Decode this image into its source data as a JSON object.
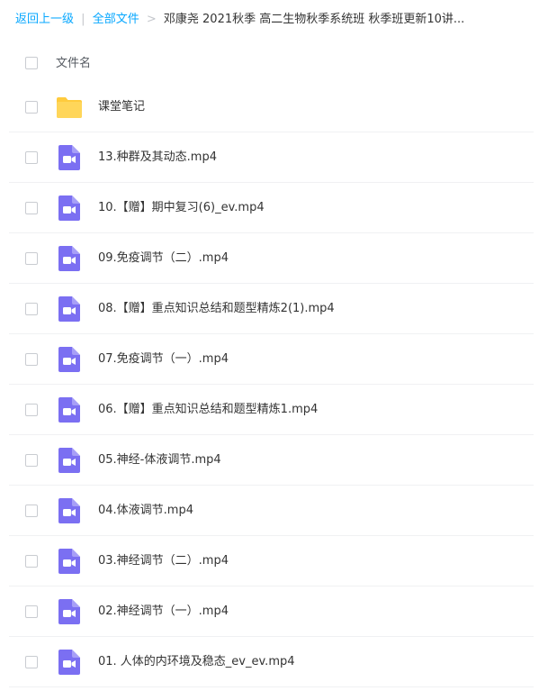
{
  "breadcrumb": {
    "back_label": "返回上一级",
    "separator": "|",
    "all_files_label": "全部文件",
    "chevron": ">",
    "current_path": "邓康尧 2021秋季 高二生物秋季系统班 秋季班更新10讲..."
  },
  "list_header": {
    "name_label": "文件名"
  },
  "files": [
    {
      "name": "课堂笔记",
      "icon": "folder-icon"
    },
    {
      "name": "13.种群及其动态.mp4",
      "icon": "video-icon"
    },
    {
      "name": "10.【赠】期中复习(6)_ev.mp4",
      "icon": "video-icon"
    },
    {
      "name": "09.免疫调节（二）.mp4",
      "icon": "video-icon"
    },
    {
      "name": "08.【赠】重点知识总结和题型精炼2(1).mp4",
      "icon": "video-icon"
    },
    {
      "name": "07.免疫调节（一）.mp4",
      "icon": "video-icon"
    },
    {
      "name": "06.【赠】重点知识总结和题型精炼1.mp4",
      "icon": "video-icon"
    },
    {
      "name": "05.神经-体液调节.mp4",
      "icon": "video-icon"
    },
    {
      "name": "04.体液调节.mp4",
      "icon": "video-icon"
    },
    {
      "name": "03.神经调节（二）.mp4",
      "icon": "video-icon"
    },
    {
      "name": "02.神经调节（一）.mp4",
      "icon": "video-icon"
    },
    {
      "name": "01. 人体的内环境及稳态_ev_ev.mp4",
      "icon": "video-icon"
    }
  ],
  "colors": {
    "link": "#06a7ff",
    "folder": "#ffcb3d",
    "video": "#7b6ff2"
  }
}
